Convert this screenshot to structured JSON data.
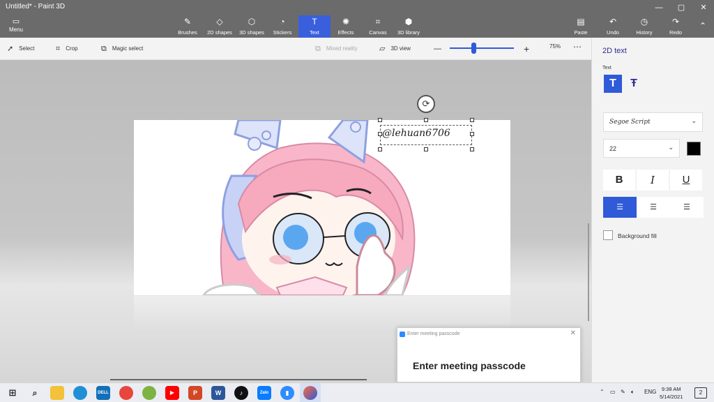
{
  "window": {
    "title": "Untitled* - Paint 3D",
    "controls": [
      "—",
      "▢",
      "✕"
    ]
  },
  "menu": {
    "label": "Menu",
    "icon": "folder-icon"
  },
  "tools": [
    {
      "label": "Brushes",
      "icon": "brush-icon"
    },
    {
      "label": "2D shapes",
      "icon": "2d-shapes-icon"
    },
    {
      "label": "3D shapes",
      "icon": "3d-shapes-icon"
    },
    {
      "label": "Stickers",
      "icon": "stickers-icon"
    },
    {
      "label": "Text",
      "icon": "text-icon",
      "active": true
    },
    {
      "label": "Effects",
      "icon": "effects-icon"
    },
    {
      "label": "Canvas",
      "icon": "canvas-icon"
    },
    {
      "label": "3D library",
      "icon": "3d-library-icon"
    }
  ],
  "actions": [
    {
      "label": "Paste",
      "icon": "paste-icon"
    },
    {
      "label": "Undo",
      "icon": "undo-icon"
    },
    {
      "label": "History",
      "icon": "history-icon"
    },
    {
      "label": "Redo",
      "icon": "redo-icon"
    }
  ],
  "subbar": {
    "select": "Select",
    "crop": "Crop",
    "magic_select": "Magic select",
    "mixed_reality": "Mixed reality",
    "view_3d": "3D view",
    "zoom": "75%",
    "zoom_level": 0.38
  },
  "canvas": {
    "text": "@lehuan6706"
  },
  "panel": {
    "title": "2D text",
    "text_label": "Text",
    "font": "Segoe Script",
    "size": "22",
    "text_color": "#000000",
    "bold": "B",
    "italic": "I",
    "underline": "U",
    "background_fill": "Background fill"
  },
  "dialog": {
    "header": "Enter meeting passcode",
    "body": "Enter meeting passcode"
  },
  "taskbar": {
    "lang": "ENG",
    "time": "9:38 AM",
    "date": "5/14/2021",
    "notif_count": "2",
    "apps": [
      "start-icon",
      "search-icon",
      "file-explorer-icon",
      "edge-icon",
      "dell-icon",
      "chrome-icon",
      "greenshot-icon",
      "youtube-icon",
      "powerpoint-icon",
      "word-icon",
      "tiktok-icon",
      "zalo-icon",
      "zoom-icon",
      "paint-3d-icon"
    ]
  },
  "colors": {
    "accent": "#2f5ad8",
    "titlebar": "#6b6b6b"
  }
}
